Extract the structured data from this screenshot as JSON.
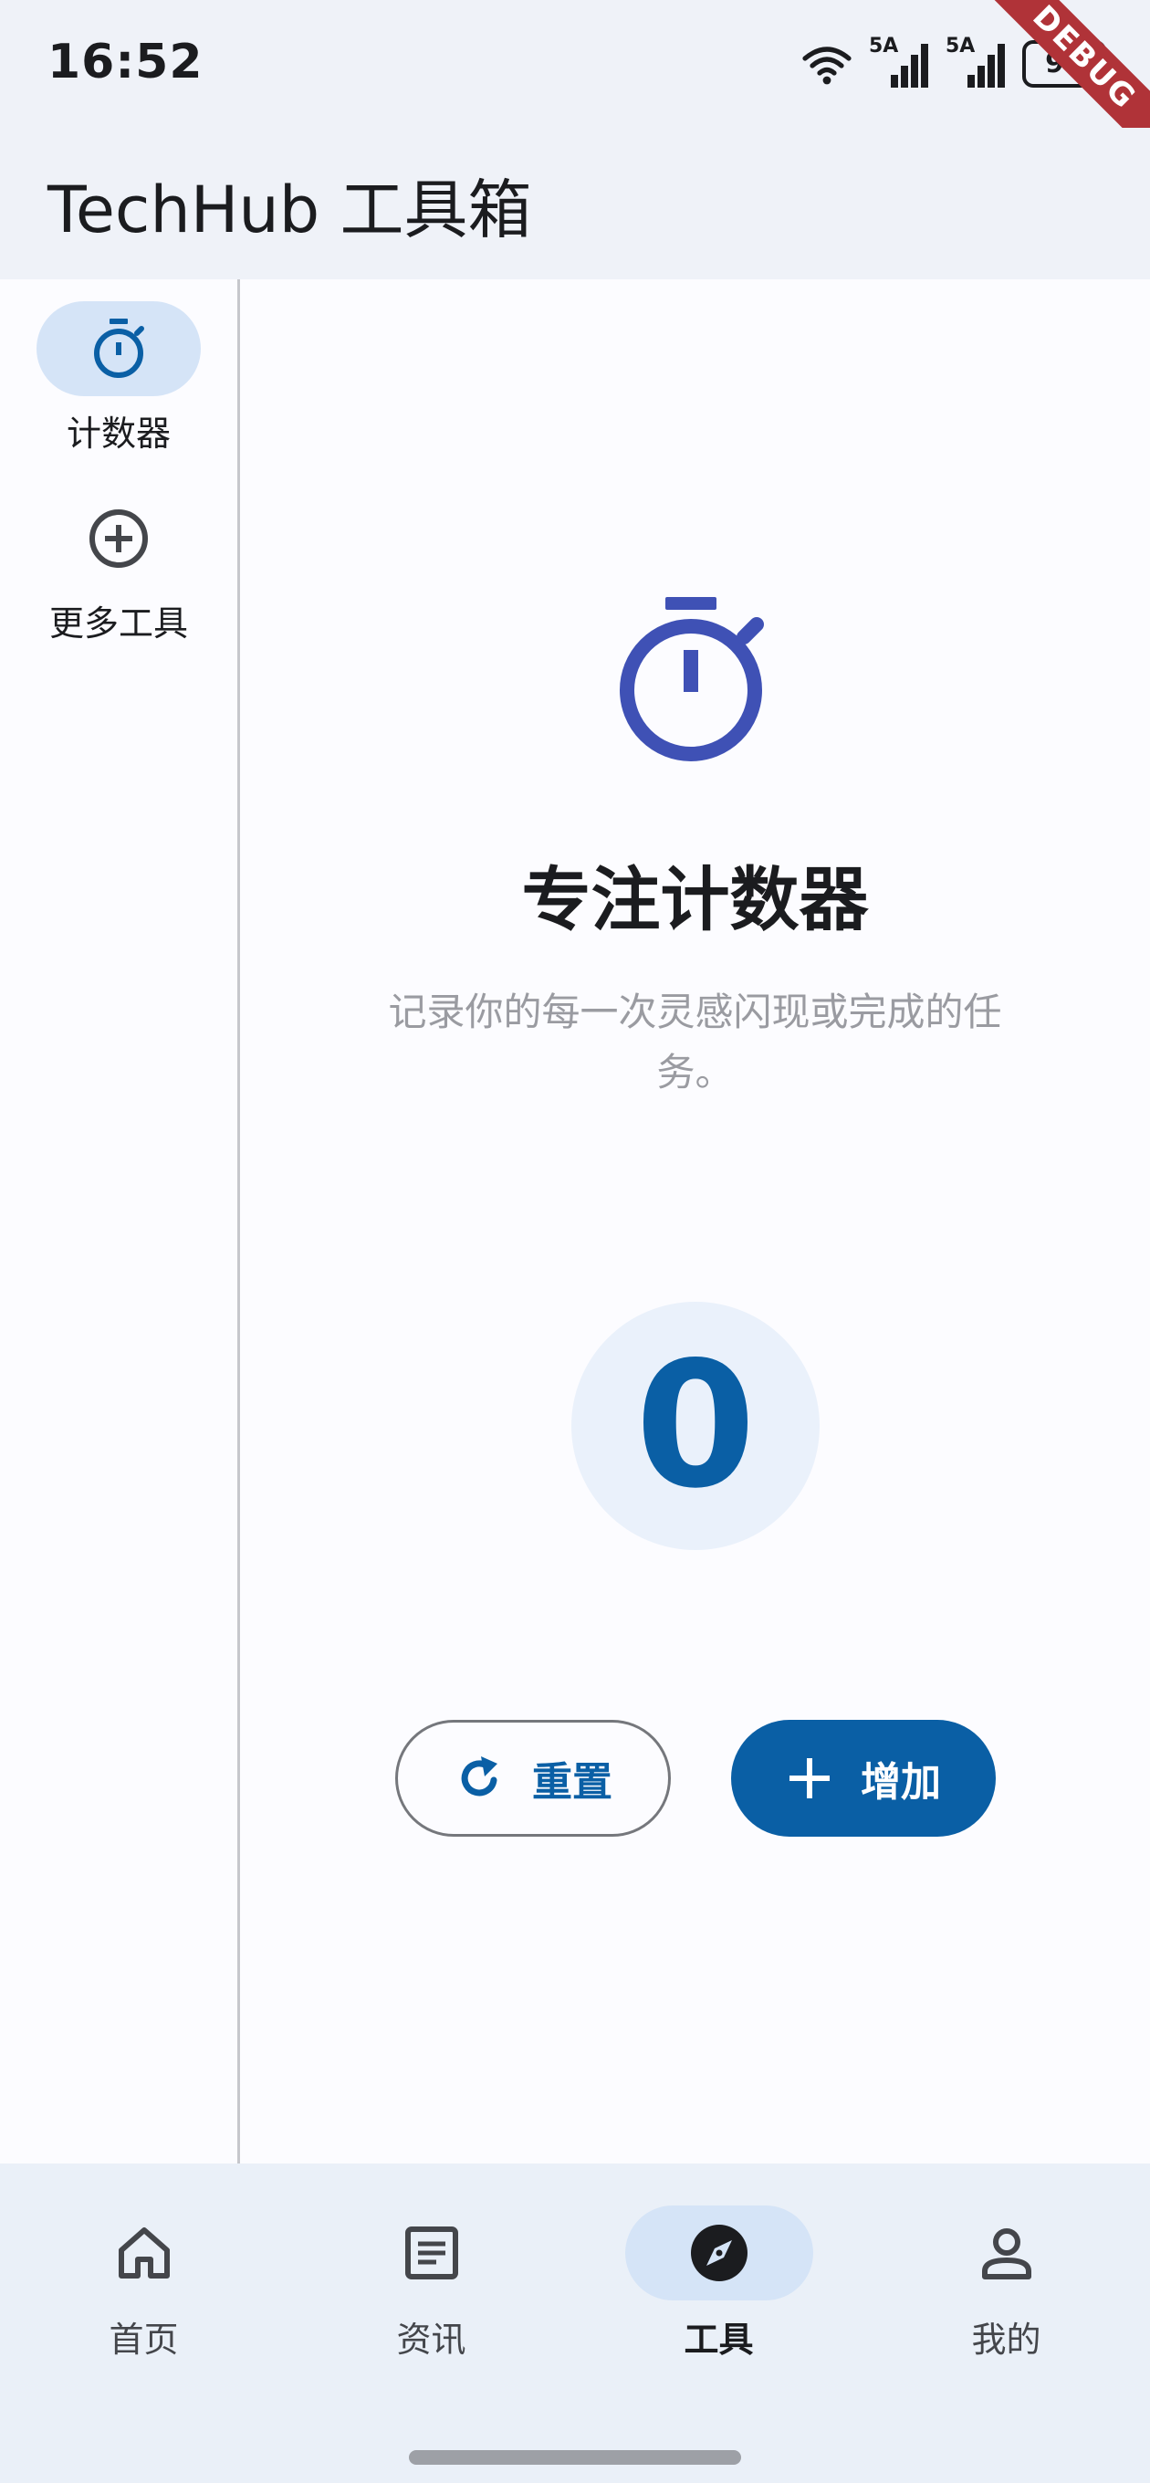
{
  "status_bar": {
    "time": "16:52",
    "network_1": "5A",
    "network_2": "5A",
    "battery": "96",
    "debug_banner": "DEBUG"
  },
  "app_bar": {
    "title": "TechHub 工具箱"
  },
  "nav_rail": {
    "items": [
      {
        "label": "计数器",
        "icon": "timer-icon",
        "selected": true
      },
      {
        "label": "更多工具",
        "icon": "add-circle-icon",
        "selected": false
      }
    ]
  },
  "counter": {
    "icon": "timer-icon",
    "title": "专注计数器",
    "description": "记录你的每一次灵感闪现或完成的任务。",
    "value": "0",
    "reset_label": "重置",
    "increment_label": "增加"
  },
  "bottom_nav": {
    "items": [
      {
        "label": "首页",
        "icon": "home-icon",
        "selected": false
      },
      {
        "label": "资讯",
        "icon": "article-icon",
        "selected": false
      },
      {
        "label": "工具",
        "icon": "compass-icon",
        "selected": true
      },
      {
        "label": "我的",
        "icon": "person-icon",
        "selected": false
      }
    ]
  },
  "colors": {
    "primary": "#0a5fa5",
    "hero_icon": "#3f51b5",
    "surface": "#fcfcff",
    "app_bar": "#eff2f8",
    "selected_indicator": "#d5e4f7",
    "counter_bg": "#eaf1fb",
    "muted_text": "#9a9ba1",
    "debug_ribbon": "#b03338"
  }
}
